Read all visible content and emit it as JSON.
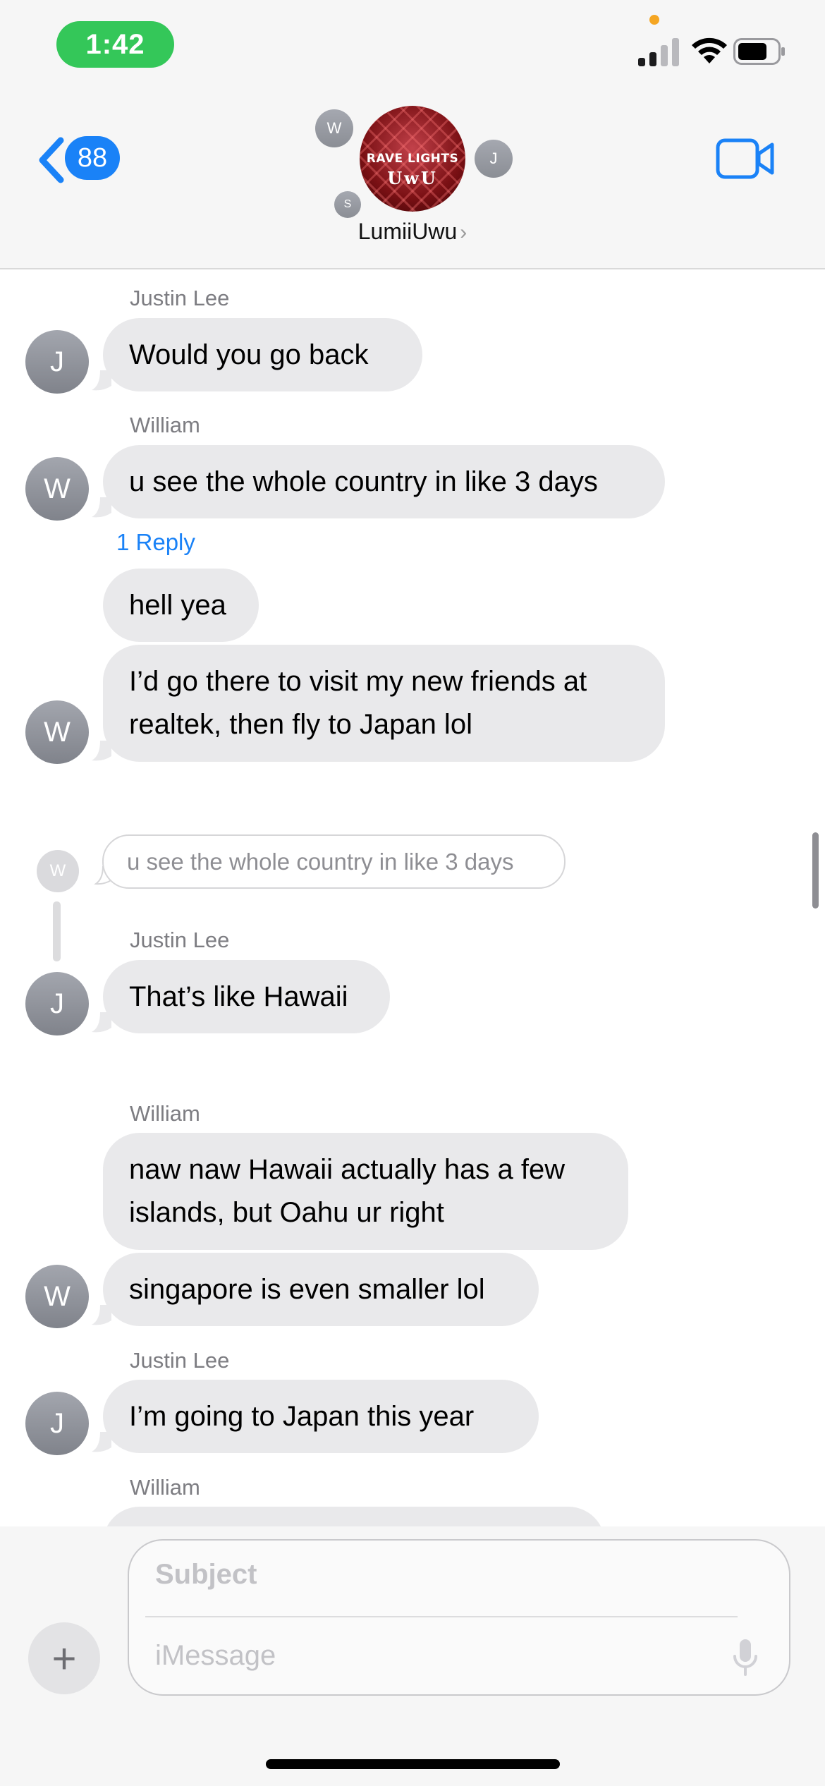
{
  "status_bar": {
    "time": "1:42"
  },
  "header": {
    "back_badge": "88",
    "group_name": "LumiiUwu",
    "name_chevron": "›",
    "avatar_logo_line1": "RAVE LIGHTS",
    "avatar_logo_line2": "UwU",
    "member_initials": {
      "top_left": "W",
      "bottom_left": "S",
      "right": "J"
    }
  },
  "messages": [
    {
      "sender": "Justin Lee",
      "text": "Would you go back",
      "avatar": "J"
    },
    {
      "sender": "William",
      "text": "u see the whole country in like 3 days",
      "avatar": "W",
      "reply_link": "1 Reply"
    },
    {
      "text": "hell yea"
    },
    {
      "text_line1": "I’d go there to visit my new friends at",
      "text_line2": "realtek, then fly to Japan lol",
      "avatar": "W"
    },
    {
      "quote": "u see the whole country in like 3 days",
      "quote_avatar": "W"
    },
    {
      "sender": "Justin Lee",
      "text": "That’s like Hawaii",
      "avatar": "J"
    },
    {
      "sender": "William",
      "text_line1": "naw naw Hawaii actually has a few",
      "text_line2": "islands, but Oahu ur right"
    },
    {
      "text": "singapore is even smaller lol",
      "avatar": "W"
    },
    {
      "sender": "Justin Lee",
      "text": "I’m going to Japan this year",
      "avatar": "J"
    },
    {
      "sender": "William"
    }
  ],
  "composer": {
    "plus": "+",
    "subject_placeholder": "Subject",
    "message_placeholder": "iMessage"
  },
  "colors": {
    "accent": "#1a82f7",
    "bubble_gray": "#e9e9eb",
    "time_pill_green": "#34c759"
  },
  "icons": [
    "back-chevron-icon",
    "video-camera-icon",
    "signal-icon",
    "wifi-icon",
    "battery-icon",
    "plus-icon",
    "microphone-icon"
  ]
}
